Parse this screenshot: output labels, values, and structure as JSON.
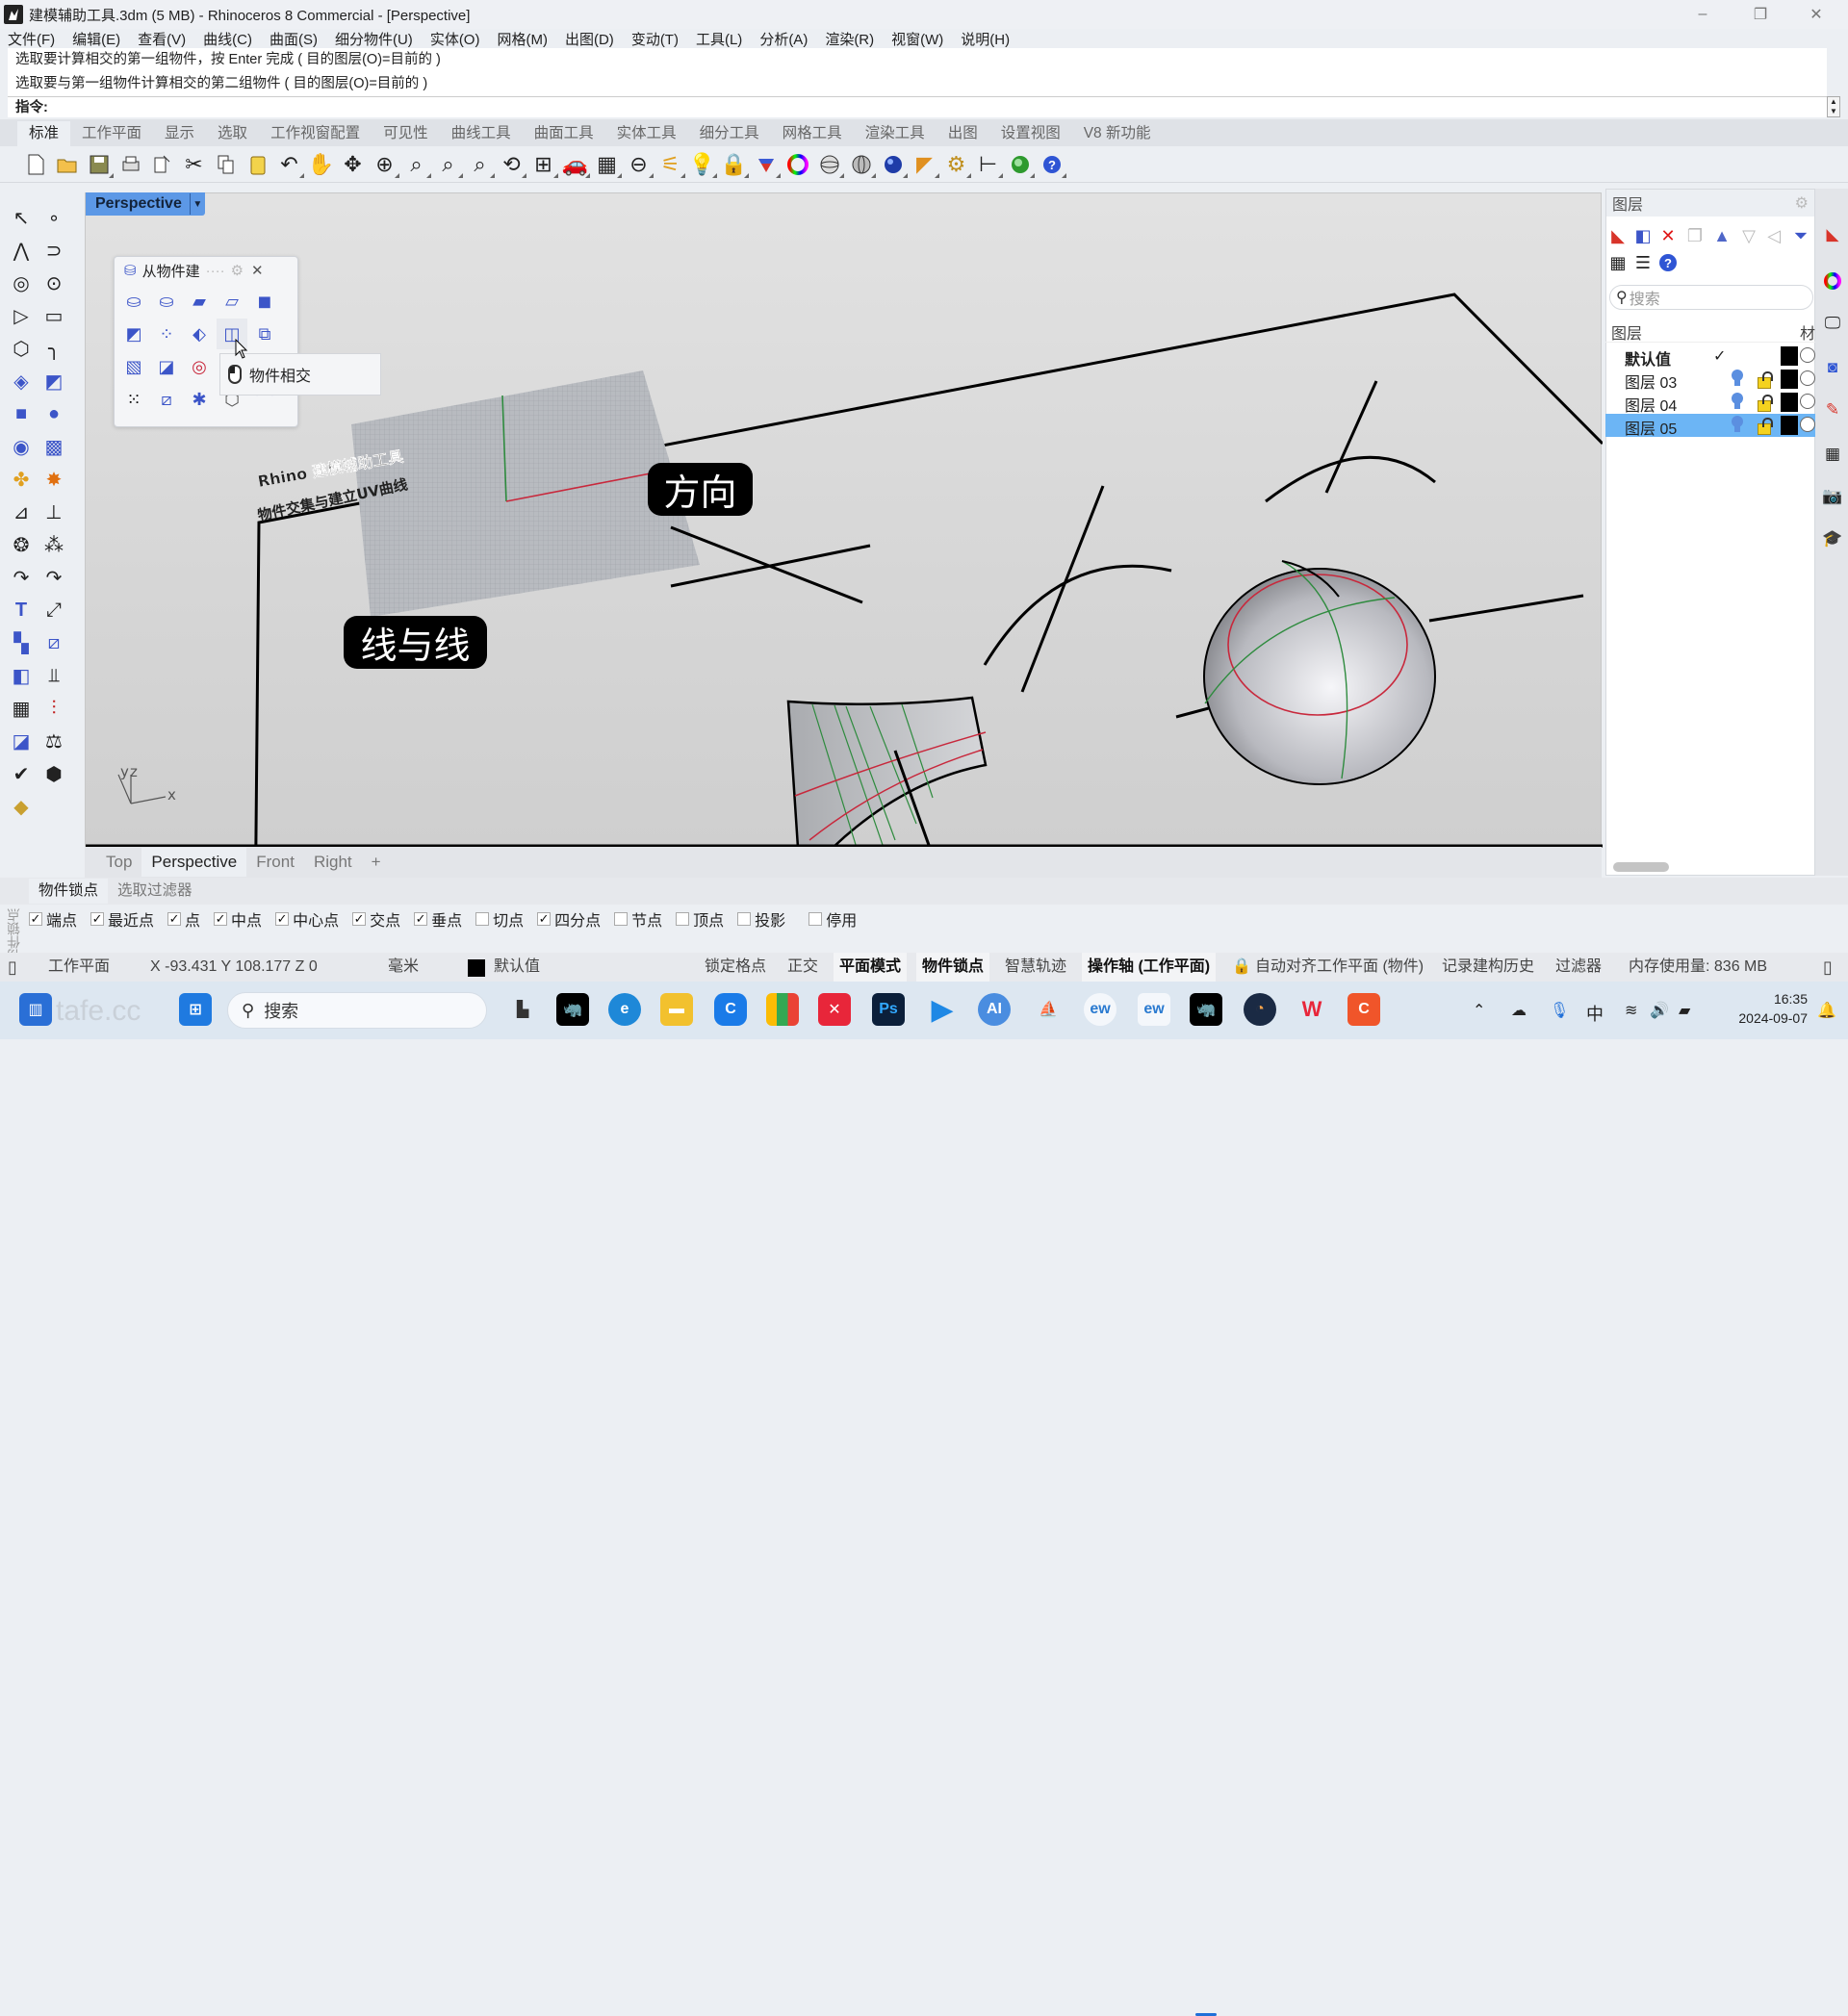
{
  "window": {
    "title": "建模辅助工具.3dm (5 MB) - Rhinoceros 8 Commercial - [Perspective]",
    "controls": {
      "minimize": "–",
      "restore": "❐",
      "close": "✕"
    }
  },
  "menu": [
    "文件(F)",
    "编辑(E)",
    "查看(V)",
    "曲线(C)",
    "曲面(S)",
    "细分物件(U)",
    "实体(O)",
    "网格(M)",
    "出图(D)",
    "变动(T)",
    "工具(L)",
    "分析(A)",
    "渲染(R)",
    "视窗(W)",
    "说明(H)"
  ],
  "command": {
    "history": [
      "选取要计算相交的第一组物件，按 Enter 完成 ( 目的图层(O)=目前的 )",
      "选取要与第一组物件计算相交的第二组物件 ( 目的图层(O)=目前的 )"
    ],
    "prompt": "指令:",
    "value": ""
  },
  "toolbar_tabs": {
    "items": [
      "标准",
      "工作平面",
      "显示",
      "选取",
      "工作视窗配置",
      "可见性",
      "曲线工具",
      "曲面工具",
      "实体工具",
      "细分工具",
      "网格工具",
      "渲染工具",
      "出图",
      "设置视图",
      "V8 新功能"
    ],
    "active": "标准"
  },
  "toolbar_icons": [
    "new-file-icon",
    "open-folder-icon",
    "save-icon",
    "print-icon",
    "import-icon",
    "cut-icon",
    "copy-icon",
    "paste-icon",
    "undo-icon",
    "pan-hand-icon",
    "rotate-view-icon",
    "zoom-dynamic-icon",
    "zoom-window-icon",
    "zoom-extents-icon",
    "zoom-selected-icon",
    "undo-view-icon",
    "four-viewports-icon",
    "car-icon",
    "grid-snap-icon",
    "cplane-icon",
    "gumball-icon",
    "light-icon",
    "lock-icon",
    "layer-icon",
    "color-wheel-icon",
    "wireframe-sphere-icon",
    "rendered-sphere-icon",
    "render-sphere-icon",
    "properties-icon",
    "settings-gear-icon",
    "dimension-icon",
    "record-icon",
    "help-icon"
  ],
  "viewport": {
    "name": "Perspective",
    "text_object": {
      "line1": "Rhino  建模辅助工具",
      "line2": "物件交集与建立UV曲线"
    },
    "labels": {
      "direction": "方向",
      "line_to_line": "线与线"
    },
    "axes": {
      "x": "x",
      "y": "y",
      "z": "z"
    }
  },
  "floating_panel": {
    "title": "从物件建",
    "tooltip": "物件相交"
  },
  "view_tabs": {
    "items": [
      "Top",
      "Perspective",
      "Front",
      "Right"
    ],
    "active": "Perspective",
    "add": "+"
  },
  "layers": {
    "panel_title": "图层",
    "search_placeholder": "搜索",
    "col_name": "图层",
    "col_material": "材",
    "rows": [
      {
        "name": "默认值",
        "current": true,
        "selected": false,
        "color": "#000000"
      },
      {
        "name": "图层 03",
        "current": false,
        "selected": false,
        "color": "#000000"
      },
      {
        "name": "图层 04",
        "current": false,
        "selected": false,
        "color": "#000000"
      },
      {
        "name": "图层 05",
        "current": false,
        "selected": true,
        "color": "#000000"
      }
    ],
    "current_mark": "✓"
  },
  "osnap": {
    "tabs": [
      "物件锁点",
      "选取过滤器"
    ],
    "active_tab": "物件锁点",
    "side_label": "物件锁点",
    "items": [
      {
        "label": "端点",
        "checked": true
      },
      {
        "label": "最近点",
        "checked": true
      },
      {
        "label": "点",
        "checked": true
      },
      {
        "label": "中点",
        "checked": true
      },
      {
        "label": "中心点",
        "checked": true
      },
      {
        "label": "交点",
        "checked": true
      },
      {
        "label": "垂点",
        "checked": true
      },
      {
        "label": "切点",
        "checked": false
      },
      {
        "label": "四分点",
        "checked": true
      },
      {
        "label": "节点",
        "checked": false
      },
      {
        "label": "顶点",
        "checked": false
      },
      {
        "label": "投影",
        "checked": false
      },
      {
        "label": "停用",
        "checked": false
      }
    ]
  },
  "status": {
    "cplane": "工作平面",
    "coords": "X -93.431 Y 108.177 Z 0",
    "units": "毫米",
    "layer": "默认值",
    "grid_snap": "锁定格点",
    "ortho": "正交",
    "planar": "平面模式",
    "osnap": "物件锁点",
    "smarttrack": "智慧轨迹",
    "gumball": "操作轴 (工作平面)",
    "autoalign": "自动对齐工作平面 (物件)",
    "history": "记录建构历史",
    "filter": "过滤器",
    "memory": "内存使用量: 836 MB"
  },
  "taskbar": {
    "watermark": "tafe.cc",
    "search_placeholder": "搜索",
    "time": "16:35",
    "date": "2024-09-07",
    "ime": "中"
  },
  "colors": {
    "accent": "#5c98e6",
    "layer_selected": "#6cb5f5",
    "viewport_bg": "#d9d9d9",
    "u_curve": "#c8283c",
    "v_curve": "#2e8b3e"
  }
}
